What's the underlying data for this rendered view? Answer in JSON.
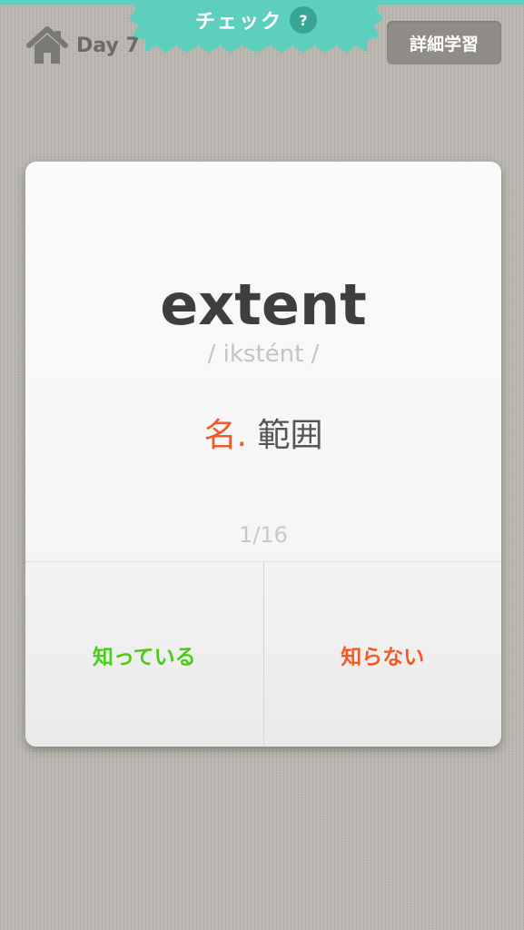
{
  "header": {
    "day_label": "Day 7",
    "mode_title": "チェック",
    "help_label": "?",
    "detail_button": "詳細学習"
  },
  "card": {
    "word": "extent",
    "pronunciation": "/ ikstént /",
    "part_of_speech": "名.",
    "meaning": "範囲",
    "counter": "1/16",
    "known_button": "知っている",
    "unknown_button": "知らない"
  },
  "icons": {
    "home": "home-icon",
    "help": "question-icon"
  },
  "colors": {
    "accent_teal": "#5fcfbd",
    "known_green": "#4ccc17",
    "unknown_orange": "#f25b26",
    "part_of_speech": "#f05a28"
  }
}
